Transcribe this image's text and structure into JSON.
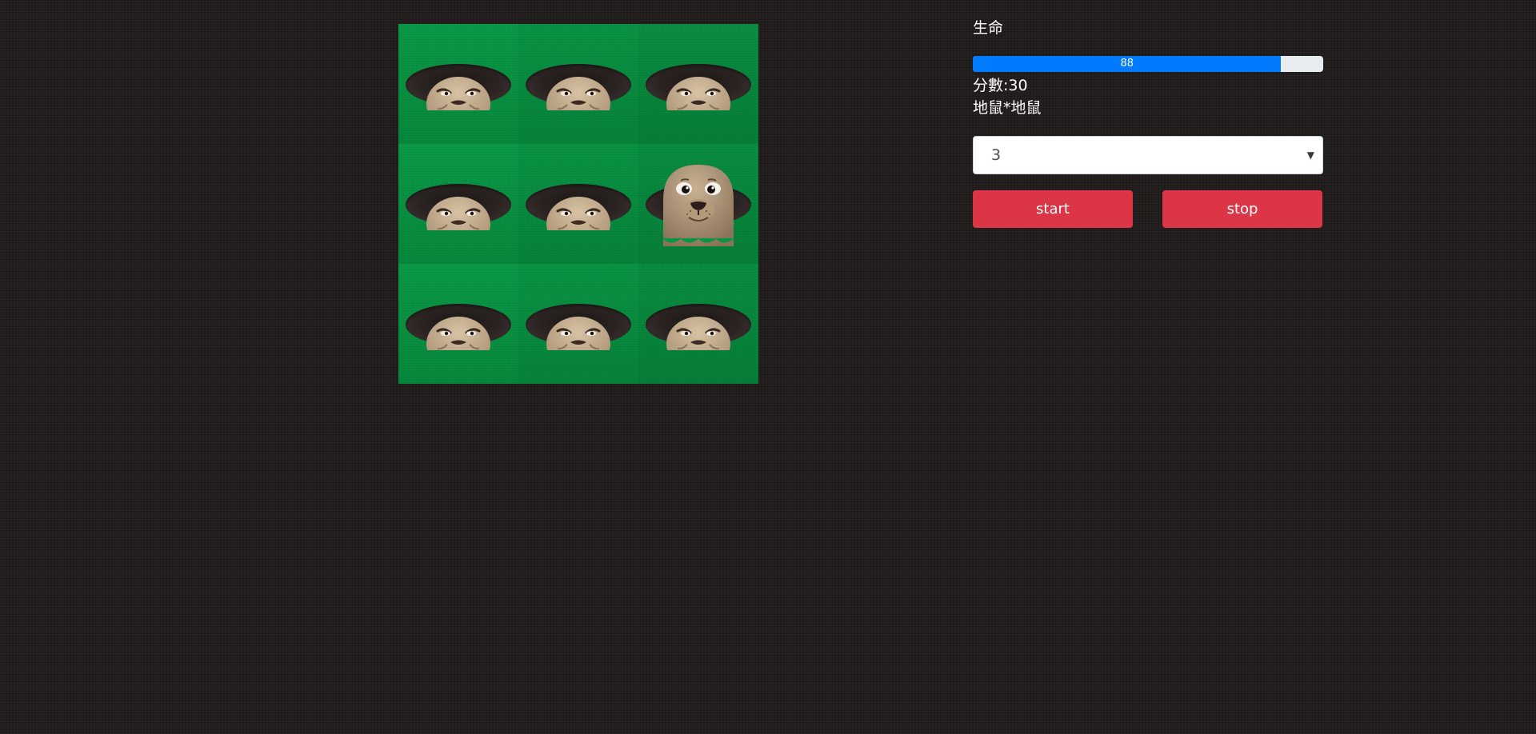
{
  "game": {
    "board": {
      "rows": 3,
      "cols": 3,
      "active_holes": [
        [
          1,
          2
        ]
      ]
    }
  },
  "panel": {
    "life_label": "生命",
    "life_value": 88,
    "life_text": "88",
    "score_label": "分數:",
    "score_value": "30",
    "mode_text": "地鼠*地鼠",
    "level_select": {
      "selected": "3"
    },
    "start_label": "start",
    "stop_label": "stop"
  },
  "colors": {
    "background": "#231f1e",
    "grass": "#0a9445",
    "progress_fill": "#007bff",
    "progress_track": "#e9ecef",
    "button": "#dc3545"
  },
  "icons": {
    "mole_hidden": "mole-peeking-icon",
    "mole_up": "mole-popped-up-icon",
    "select_caret": "chevron-down-icon"
  }
}
